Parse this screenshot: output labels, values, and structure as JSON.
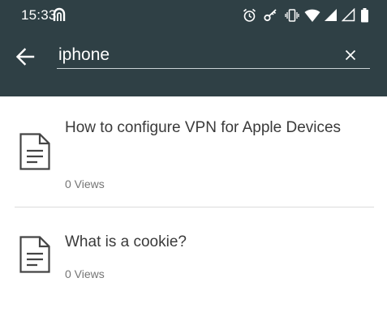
{
  "status_bar": {
    "time": "15:33",
    "icons": [
      "app-notification-icon",
      "alarm-icon",
      "key-icon",
      "vibrate-icon",
      "wifi-icon",
      "signal-icon",
      "signal-empty-icon",
      "battery-icon"
    ]
  },
  "search": {
    "value": "iphone",
    "back_icon": "arrow-back-icon",
    "clear_icon": "close-icon"
  },
  "results": [
    {
      "title": "How to configure VPN for Apple Devices",
      "views": "0 Views",
      "icon": "document-icon"
    },
    {
      "title": "What is a cookie?",
      "views": "0 Views",
      "icon": "document-icon"
    }
  ],
  "colors": {
    "app_bar": "#2f4045",
    "text_primary": "#3a3a3a",
    "text_secondary": "#757575"
  }
}
